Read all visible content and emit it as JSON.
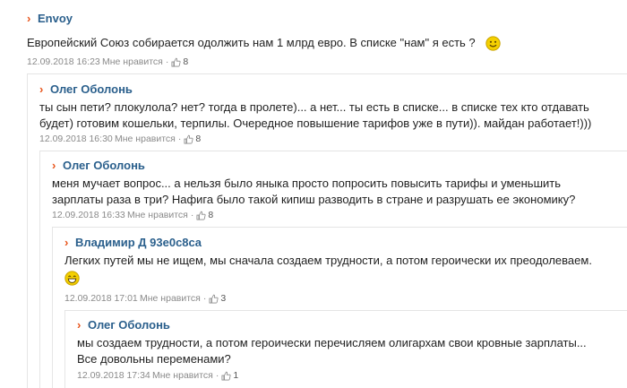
{
  "comments": [
    {
      "author": "Envoy",
      "text_lines": [
        "Европейский Союз собирается одолжить нам 1 млрд евро. В списке \"нам\" я есть ?"
      ],
      "date": "12.09.2018 16:23",
      "like_label": "Мне нравится",
      "likes": "8"
    },
    {
      "author": "Олег Оболонь",
      "text_lines": [
        "ты сын пети? плокулола? нет? тогда в пролете)... а нет... ты есть в списке... в списке тех кто отдавать",
        "будет) готовим кошельки, терпилы. Очередное повышение тарифов уже в пути)). майдан работает!)))"
      ],
      "date": "12.09.2018 16:30",
      "like_label": "Мне нравится",
      "likes": "8"
    },
    {
      "author": "Олег Оболонь",
      "text_lines": [
        "меня мучает вопрос... а нельзя было яныка просто попросить повысить тарифы и уменьшить",
        "зарплаты раза в три? Нафига было такой кипиш разводить в стране и разрушать ее экономику?"
      ],
      "date": "12.09.2018 16:33",
      "like_label": "Мне нравится",
      "likes": "8"
    },
    {
      "author": "Владимир Д 93e0c8ca",
      "text_lines": [
        "Легких путей мы не ищем, мы сначала создаем трудности, а потом героически их преодолеваем."
      ],
      "date": "12.09.2018 17:01",
      "like_label": "Мне нравится",
      "likes": "3"
    },
    {
      "author": "Олег Оболонь",
      "text_lines": [
        "мы создаем трудности, а потом героически перечисляем олигархам свои кровные зарплаты...",
        "Все довольны переменами?"
      ],
      "date": "12.09.2018 17:34",
      "like_label": "Мне нравится",
      "likes": "1"
    }
  ],
  "separator": "·",
  "icons": {
    "chevron": "chevron-right-icon",
    "thumb": "thumbs-up-icon",
    "smiley": "smiley-icon",
    "laughing": "laughing-smiley-icon"
  },
  "colors": {
    "author": "#2a5f8c",
    "chevron": "#e8541a",
    "meta": "#8a8a8a",
    "smiley": "#f4d000"
  }
}
